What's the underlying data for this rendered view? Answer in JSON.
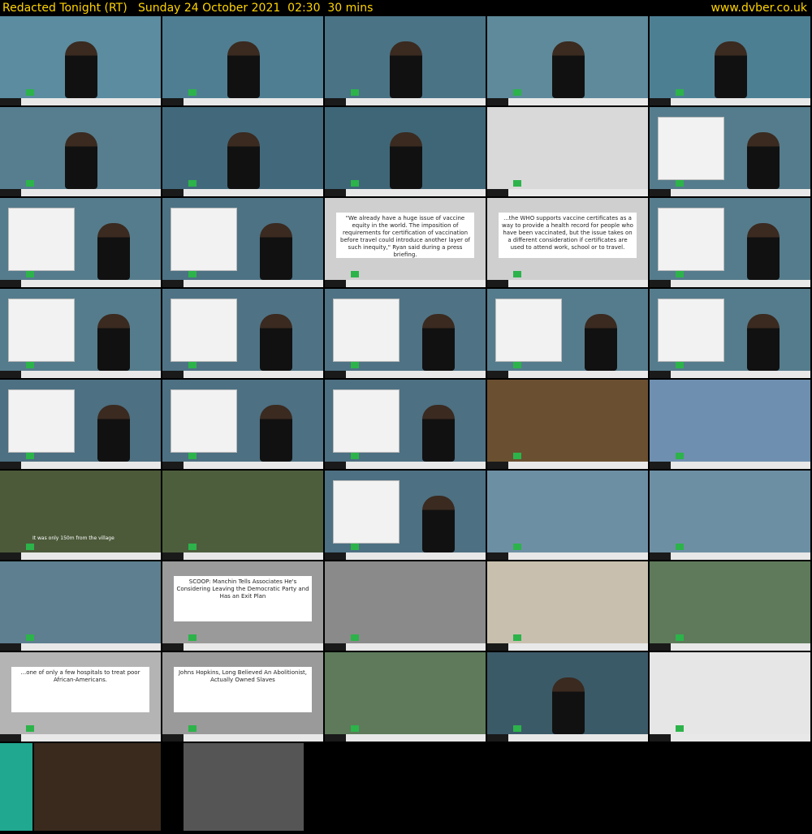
{
  "header": {
    "title": "Redacted Tonight (RT)   Sunday 24 October 2021  02:30  30 mins",
    "site": "www.dvber.co.uk"
  },
  "thumbnails": [
    {
      "bg": "#5b8ca0",
      "kind": "studio"
    },
    {
      "bg": "#4f7e92",
      "kind": "studio"
    },
    {
      "bg": "#4a7386",
      "kind": "studio"
    },
    {
      "bg": "#5e8a9b",
      "kind": "studio"
    },
    {
      "bg": "#4d7f93",
      "kind": "studio"
    },
    {
      "bg": "#567e8f",
      "kind": "studio"
    },
    {
      "bg": "#42697b",
      "kind": "studio"
    },
    {
      "bg": "#3f6677",
      "kind": "studio"
    },
    {
      "bg": "#d9d9d9",
      "kind": "paper"
    },
    {
      "bg": "#557c8c",
      "kind": "card"
    },
    {
      "bg": "#557c8c",
      "kind": "card"
    },
    {
      "bg": "#4c7284",
      "kind": "card"
    },
    {
      "bg": "#cfcfcf",
      "kind": "quote",
      "text": "\"We already have a huge issue of vaccine equity in the world. The imposition of requirements for certification of vaccination before travel could introduce another layer of such inequity,\" Ryan said during a press briefing."
    },
    {
      "bg": "#cfcfcf",
      "kind": "quote",
      "text": "...the WHO supports vaccine certificates as a way to provide a health record for people who have been vaccinated, but the issue takes on a different consideration if certificates are used to attend work, school or to travel."
    },
    {
      "bg": "#557c8c",
      "kind": "card"
    },
    {
      "bg": "#557c8c",
      "kind": "card"
    },
    {
      "bg": "#4f7385",
      "kind": "card"
    },
    {
      "bg": "#4f7385",
      "kind": "card"
    },
    {
      "bg": "#557c8c",
      "kind": "card"
    },
    {
      "bg": "#557c8c",
      "kind": "card"
    },
    {
      "bg": "#4d7082",
      "kind": "card"
    },
    {
      "bg": "#4d7082",
      "kind": "card"
    },
    {
      "bg": "#4d7082",
      "kind": "card"
    },
    {
      "bg": "#6a5030",
      "kind": "plain"
    },
    {
      "bg": "#6f8fb0",
      "kind": "plain"
    },
    {
      "bg": "#4c5a3a",
      "kind": "caption",
      "text": "It was only 150m from the village"
    },
    {
      "bg": "#4d5e3d",
      "kind": "plain"
    },
    {
      "bg": "#4d7082",
      "kind": "card"
    },
    {
      "bg": "#6d8fa4",
      "kind": "plain"
    },
    {
      "bg": "#6d8fa4",
      "kind": "plain"
    },
    {
      "bg": "#5d7f8f",
      "kind": "plain"
    },
    {
      "bg": "#9a9a9a",
      "kind": "quote",
      "text": "SCOOP: Manchin Tells Associates He's Considering Leaving the Democratic Party and Has an Exit Plan"
    },
    {
      "bg": "#8a8a8a",
      "kind": "plain"
    },
    {
      "bg": "#c8bfae",
      "kind": "plain"
    },
    {
      "bg": "#5e7a5a",
      "kind": "plain"
    },
    {
      "bg": "#b4b4b4",
      "kind": "quote",
      "text": "...one of only a few hospitals to treat poor African-Americans."
    },
    {
      "bg": "#9a9a9a",
      "kind": "quote",
      "text": "Johns Hopkins, Long Believed An Abolitionist, Actually Owned Slaves"
    },
    {
      "bg": "#5e7a5a",
      "kind": "plain"
    },
    {
      "bg": "#3b5a68",
      "kind": "studio"
    },
    {
      "bg": "#e6e6e6",
      "kind": "plain"
    },
    {
      "bg": "#21a890",
      "kind": "plain"
    },
    {
      "bg": "#3a2a1e",
      "kind": "plain"
    },
    {
      "bg": "#555555",
      "kind": "plain"
    }
  ]
}
